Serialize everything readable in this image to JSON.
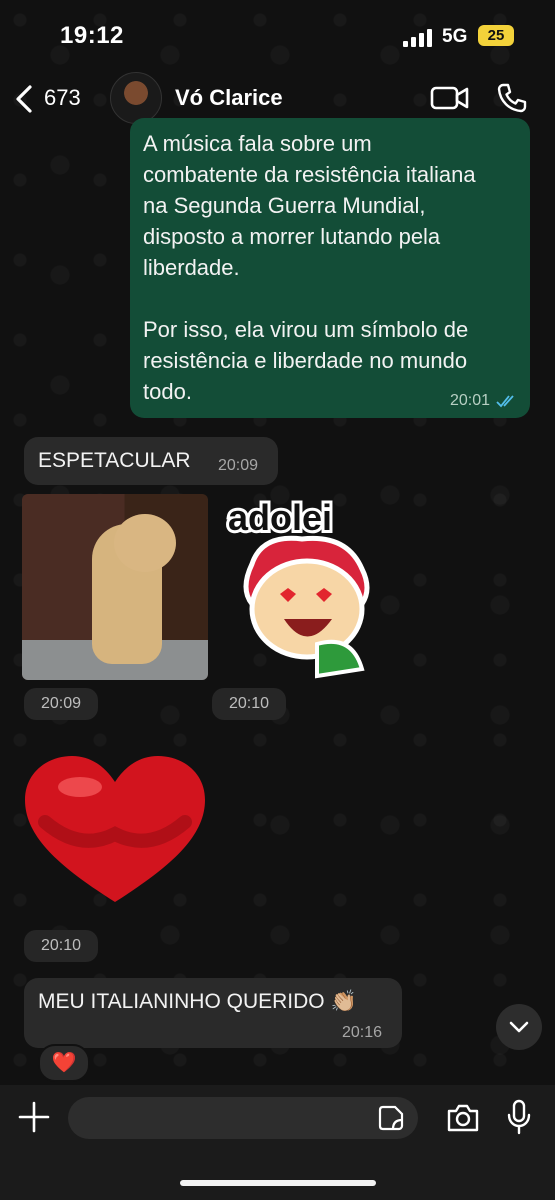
{
  "status_bar": {
    "time": "19:12",
    "network": "5G",
    "battery": "25"
  },
  "header": {
    "back_count": "673",
    "contact_name": "Vó Clarice"
  },
  "messages": {
    "outgoing": {
      "lines": [
        "A música fala sobre um",
        "combatente da resistência italiana",
        "na Segunda Guerra Mundial,",
        "disposto a morrer lutando pela",
        "liberdade.",
        "",
        "Por isso, ela virou um símbolo de",
        "resistência e liberdade no mundo",
        "todo."
      ],
      "time": "20:01"
    },
    "espetacular": {
      "text": "ESPETACULAR",
      "time": "20:09"
    },
    "dog_sticker": {
      "time": "20:09"
    },
    "adolei_sticker": {
      "caption": "adolei",
      "time": "20:10"
    },
    "heart_sticker": {
      "time": "20:10"
    },
    "italianinho": {
      "text": "MEU ITALIANINHO QUERIDO 👏🏼",
      "time": "20:16",
      "reaction": "❤️"
    }
  },
  "input_bar": {
    "placeholder": ""
  }
}
